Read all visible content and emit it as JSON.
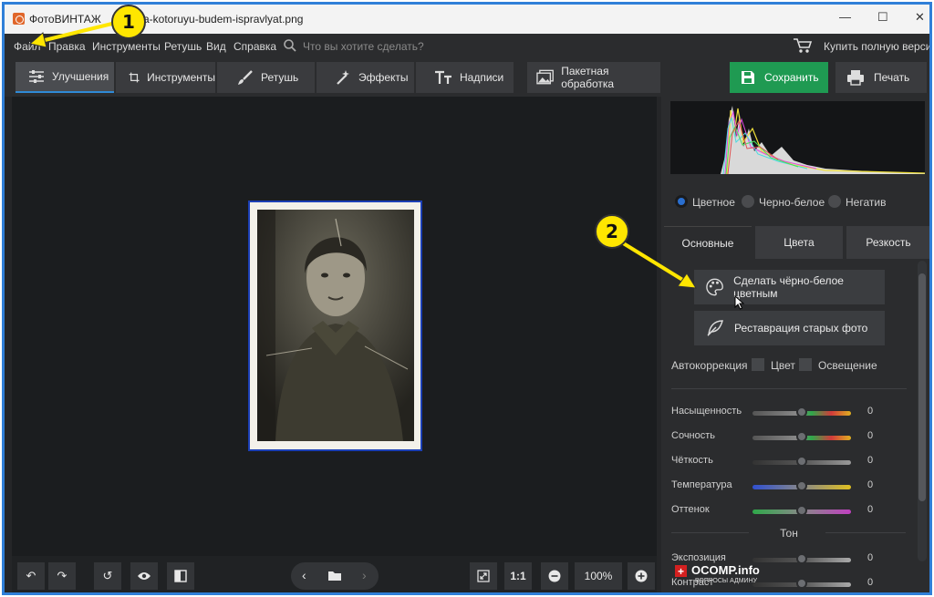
{
  "window": {
    "app_title": "ФотоВИНТАЖ",
    "filename_partial": "ya-kotoruyu-budem-ispravlyat.png",
    "minimize": "—",
    "maximize": "☐",
    "close": "✕"
  },
  "menu": {
    "items": [
      "Файл",
      "Правка",
      "Инструменты",
      "Ретушь",
      "Вид",
      "Справка"
    ],
    "search_placeholder": "Что вы хотите сделать?",
    "buy_label": "Купить полную версию"
  },
  "toolbar": {
    "tabs": [
      "Улучшения",
      "Инструменты",
      "Ретушь",
      "Эффекты",
      "Надписи"
    ],
    "batch_label": "Пакетная обработка",
    "save_label": "Сохранить",
    "print_label": "Печать"
  },
  "bottom": {
    "ratio_label": "1:1",
    "zoom": "100%"
  },
  "panel": {
    "modes": [
      "Цветное",
      "Черно-белое",
      "Негатив"
    ],
    "selected_mode": "Цветное",
    "tabs": [
      "Основные",
      "Цвета",
      "Резкость"
    ],
    "colorize_label": "Сделать чёрно-белое цветным",
    "restore_label": "Реставрация старых фото",
    "autocorrect_label": "Автокоррекция",
    "auto_color": "Цвет",
    "auto_light": "Освещение",
    "sliders": [
      {
        "label": "Насыщенность",
        "value": "0"
      },
      {
        "label": "Сочность",
        "value": "0"
      },
      {
        "label": "Чёткость",
        "value": "0"
      },
      {
        "label": "Температура",
        "value": "0"
      },
      {
        "label": "Оттенок",
        "value": "0"
      }
    ],
    "tone_title": "Тон",
    "tone_sliders": [
      {
        "label": "Экспозиция",
        "value": "0"
      },
      {
        "label": "Контраст",
        "value": "0"
      }
    ]
  },
  "annotations": {
    "badge_1": "1",
    "badge_2": "2",
    "watermark_title": "OCOMP.info",
    "watermark_sub": "ВОПРОСЫ АДМИНУ"
  },
  "colors": {
    "accent_blue": "#2f8ad6",
    "save_green": "#1f9a52",
    "badge_yellow": "#ffe600"
  }
}
